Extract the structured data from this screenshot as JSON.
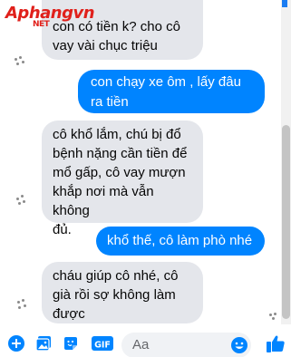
{
  "watermark": {
    "brand": "Aphangvn",
    "suffix": "NET"
  },
  "messages": [
    {
      "side": "received",
      "text": "con có tiền k? cho cô\nvay vài chục triệu"
    },
    {
      "side": "sent",
      "text": "con chạy xe ôm , lấy đâu\nra tiền"
    },
    {
      "side": "received",
      "text": "cô khổ lắm, chú bị đổ\nbệnh nặng cần tiền để\nmổ gấp, cô vay mượn\nkhắp nơi mà vẫn không\nđủ."
    },
    {
      "side": "sent",
      "text": "khổ thế, cô làm phò nhé"
    },
    {
      "side": "received",
      "text": "cháu giúp cô nhé, cô\ngià rồi sợ không làm\nđược"
    }
  ],
  "composer": {
    "placeholder": "Aa",
    "icons": [
      "plus-icon",
      "photo-icon",
      "sticker-icon",
      "gif-icon",
      "emoji-icon",
      "like-icon"
    ],
    "gif_label": "GIF"
  },
  "colors": {
    "accent": "#0084ff",
    "received_bubble": "#e4e6eb",
    "watermark": "#e0201b"
  }
}
